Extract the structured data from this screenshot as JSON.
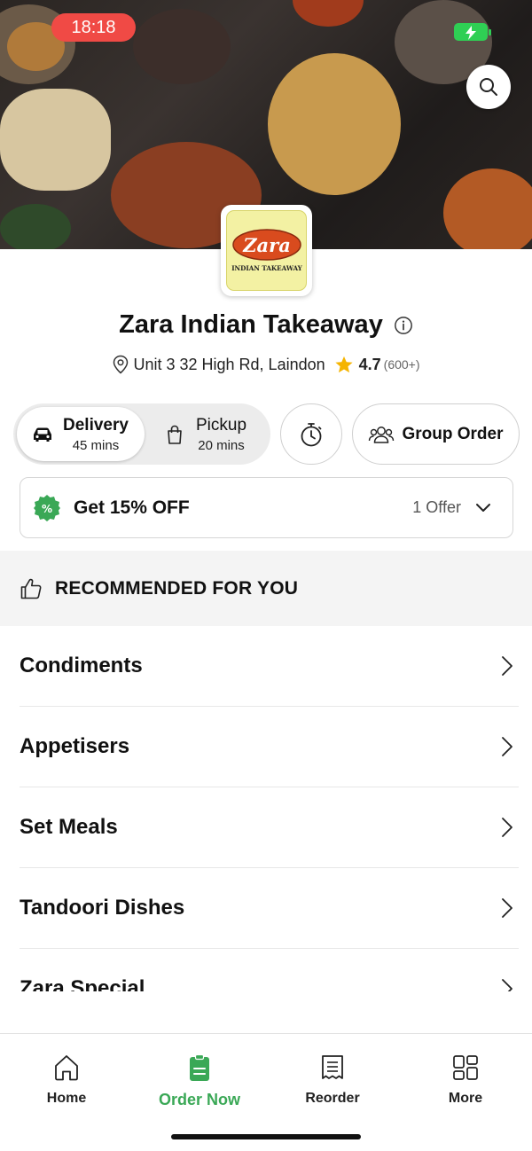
{
  "status_bar": {
    "time": "18:18",
    "battery_icon": "battery-charging-icon"
  },
  "restaurant": {
    "logo_text": "Zara",
    "logo_subtext": "INDIAN TAKEAWAY",
    "name": "Zara Indian Takeaway",
    "address": "Unit 3 32 High Rd, Laindon",
    "rating": "4.7",
    "rating_count": "(600+)"
  },
  "order_modes": {
    "delivery": {
      "label": "Delivery",
      "time": "45 mins"
    },
    "pickup": {
      "label": "Pickup",
      "time": "20 mins"
    },
    "group_order_label": "Group Order"
  },
  "offer": {
    "title": "Get 15% OFF",
    "count": "1 Offer"
  },
  "recommended": {
    "label": "RECOMMENDED FOR YOU"
  },
  "categories": [
    "Condiments",
    "Appetisers",
    "Set Meals",
    "Tandoori Dishes",
    "Zara Special"
  ],
  "bottom_nav": {
    "home": "Home",
    "order_now": "Order Now",
    "reorder": "Reorder",
    "more": "More"
  },
  "colors": {
    "accent_green": "#3aa856",
    "star": "#f5b400",
    "status_red": "#f04a45"
  }
}
